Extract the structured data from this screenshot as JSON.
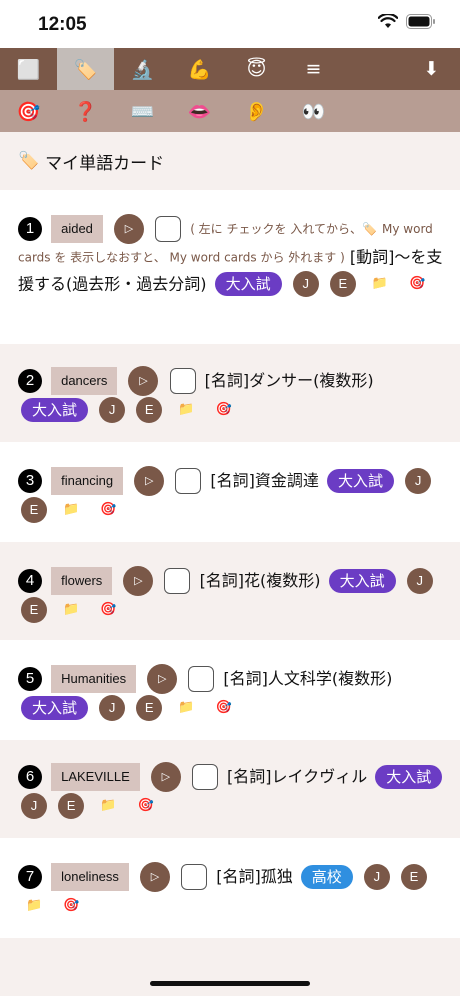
{
  "status": {
    "time": "12:05"
  },
  "toolbar": {
    "row1": [
      {
        "icon": "square-icon",
        "glyph": "⬜"
      },
      {
        "icon": "label-tag-icon",
        "glyph": "🏷️"
      },
      {
        "icon": "microscope-icon",
        "glyph": "🔬"
      },
      {
        "icon": "flexed-bicep-icon",
        "glyph": "💪"
      },
      {
        "icon": "halo-face-icon",
        "glyph": "😇"
      },
      {
        "icon": "menu-icon",
        "glyph": "≡"
      }
    ],
    "download_glyph": "⬇",
    "row2": [
      {
        "icon": "target-icon",
        "glyph": "🎯"
      },
      {
        "icon": "question-mark-icon",
        "glyph": "❓"
      },
      {
        "icon": "keyboard-icon",
        "glyph": "⌨️"
      },
      {
        "icon": "mouth-icon",
        "glyph": "👄"
      },
      {
        "icon": "ear-icon",
        "glyph": "👂"
      },
      {
        "icon": "eyes-icon",
        "glyph": "👀"
      }
    ]
  },
  "page": {
    "tag_glyph": "🏷️",
    "title": "マイ単語カード"
  },
  "glyphs": {
    "play": "▷",
    "folder": "📁",
    "target": "🎯",
    "tag": "🏷️"
  },
  "cards": [
    {
      "num": "1",
      "word": "aided",
      "note_a": "( 左に チェックを 入れてから、",
      "note_b": "My word cards を 表示しなおすと、 My word cards から 外れます )",
      "def": "[動詞]〜を支援する(過去形・過去分詞)",
      "badge": "大入試",
      "j": "J",
      "e": "E"
    },
    {
      "num": "2",
      "word": "dancers",
      "def": "[名詞]ダンサー(複数形)",
      "badge": "大入試",
      "j": "J",
      "e": "E"
    },
    {
      "num": "3",
      "word": "financing",
      "def": "[名詞]資金調達",
      "badge": "大入試",
      "j": "J",
      "e": "E"
    },
    {
      "num": "4",
      "word": "flowers",
      "def": "[名詞]花(複数形)",
      "badge": "大入試",
      "j": "J",
      "e": "E"
    },
    {
      "num": "5",
      "word": "Humanities",
      "def": "[名詞]人文科学(複数形)",
      "badge": "大入試",
      "j": "J",
      "e": "E"
    },
    {
      "num": "6",
      "word": "LAKEVILLE",
      "def": "[名詞]レイクヴィル",
      "badge": "大入試",
      "j": "J",
      "e": "E"
    },
    {
      "num": "7",
      "word": "loneliness",
      "def": "[名詞]孤独",
      "badge": "高校",
      "j": "J",
      "e": "E"
    }
  ]
}
